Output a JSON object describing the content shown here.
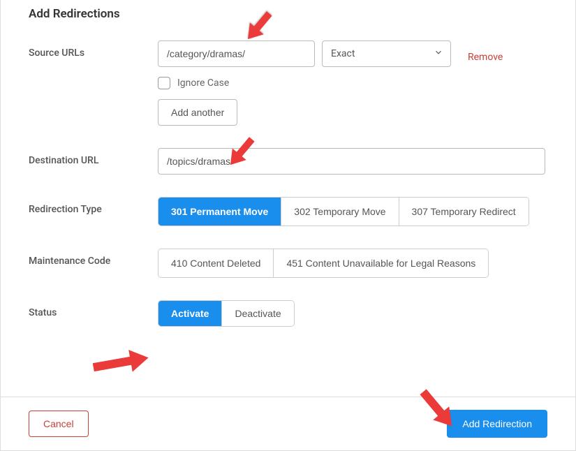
{
  "title": "Add Redirections",
  "labels": {
    "source": "Source URLs",
    "destination": "Destination URL",
    "redirection_type": "Redirection Type",
    "maintenance_code": "Maintenance Code",
    "status": "Status"
  },
  "source": {
    "value": "/category/dramas/",
    "match_type": "Exact",
    "remove": "Remove",
    "ignore_case_label": "Ignore Case",
    "add_another": "Add another"
  },
  "destination": {
    "value": "/topics/dramas/"
  },
  "redirection_type": {
    "options": [
      {
        "label": "301 Permanent Move",
        "active": true
      },
      {
        "label": "302 Temporary Move",
        "active": false
      },
      {
        "label": "307 Temporary Redirect",
        "active": false
      }
    ]
  },
  "maintenance_code": {
    "options": [
      {
        "label": "410 Content Deleted",
        "active": false
      },
      {
        "label": "451 Content Unavailable for Legal Reasons",
        "active": false
      }
    ]
  },
  "status": {
    "options": [
      {
        "label": "Activate",
        "active": true
      },
      {
        "label": "Deactivate",
        "active": false
      }
    ]
  },
  "footer": {
    "cancel": "Cancel",
    "submit": "Add Redirection"
  },
  "colors": {
    "primary": "#1a8eec",
    "danger": "#c84036",
    "arrow": "#eb3a3a"
  }
}
